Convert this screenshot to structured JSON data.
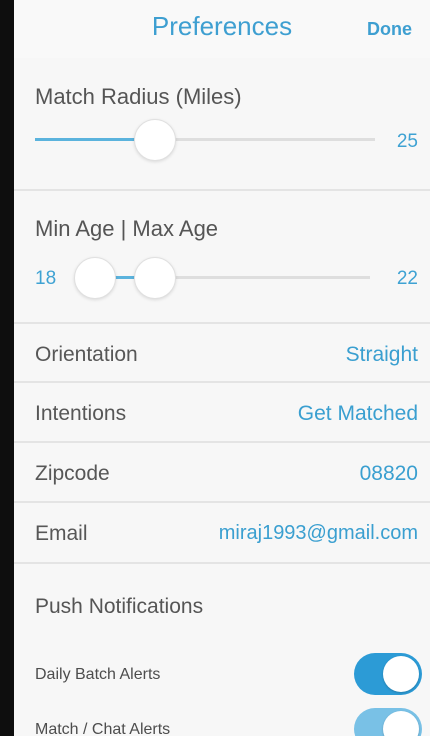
{
  "header": {
    "title": "Preferences",
    "done_label": "Done"
  },
  "match_radius": {
    "label": "Match Radius (Miles)",
    "value": "25",
    "level": 0.25
  },
  "age": {
    "label": "Min Age | Max Age",
    "min": "18",
    "max": "22"
  },
  "rows": {
    "orientation": {
      "label": "Orientation",
      "value": "Straight"
    },
    "intentions": {
      "label": "Intentions",
      "value": "Get Matched"
    },
    "zipcode": {
      "label": "Zipcode",
      "value": "08820"
    },
    "email": {
      "label": "Email",
      "value": "miraj1993@gmail.com"
    }
  },
  "push": {
    "label": "Push Notifications",
    "daily_batch": {
      "label": "Daily Batch Alerts",
      "on": true
    },
    "match_chat": {
      "label": "Match / Chat Alerts",
      "on": true
    }
  },
  "colors": {
    "accent": "#3e9fd1",
    "toggle_on": "#2c9bd6"
  }
}
